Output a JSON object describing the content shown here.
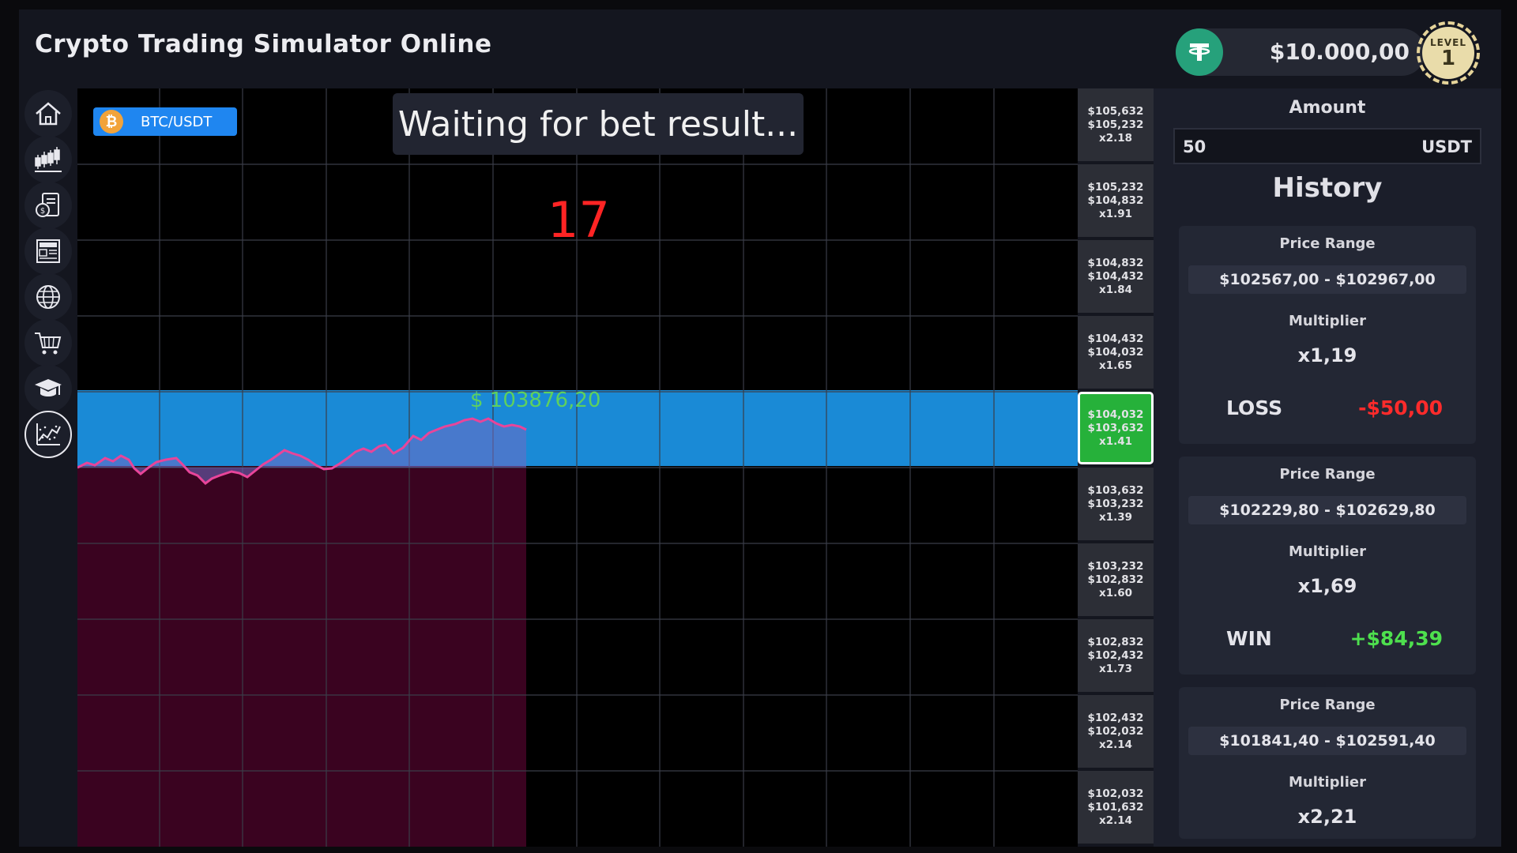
{
  "header": {
    "title": "Crypto Trading Simulator Online",
    "balance": "$10.000,00",
    "level_label": "LEVEL",
    "level_value": "1"
  },
  "sidebar": {
    "items": [
      {
        "name": "home",
        "icon": "home-icon"
      },
      {
        "name": "chart",
        "icon": "candlestick-chart-icon"
      },
      {
        "name": "coins",
        "icon": "coins-document-icon"
      },
      {
        "name": "news",
        "icon": "news-icon"
      },
      {
        "name": "globe",
        "icon": "globe-icon"
      },
      {
        "name": "shop",
        "icon": "shopping-cart-icon"
      },
      {
        "name": "learn",
        "icon": "graduation-cap-icon"
      },
      {
        "name": "stats",
        "icon": "statistics-chart-icon"
      }
    ]
  },
  "chart": {
    "pair": "BTC/USDT",
    "pair_icon": "bitcoin-icon",
    "status": "Waiting for bet result...",
    "countdown": "17",
    "current_price": "$ 103876,20",
    "colors": {
      "band": "#1a8ad6",
      "fill": "#3a0320",
      "line": "#e8459a",
      "price": "#5ed05e"
    }
  },
  "multipliers": [
    {
      "high": "$105,632",
      "low": "$105,232",
      "mult": "x2.18"
    },
    {
      "high": "$105,232",
      "low": "$104,832",
      "mult": "x1.91"
    },
    {
      "high": "$104,832",
      "low": "$104,432",
      "mult": "x1.84"
    },
    {
      "high": "$104,432",
      "low": "$104,032",
      "mult": "x1.65"
    },
    {
      "high": "$104,032",
      "low": "$103,632",
      "mult": "x1.41",
      "active": true
    },
    {
      "high": "$103,632",
      "low": "$103,232",
      "mult": "x1.39"
    },
    {
      "high": "$103,232",
      "low": "$102,832",
      "mult": "x1.60"
    },
    {
      "high": "$102,832",
      "low": "$102,432",
      "mult": "x1.73"
    },
    {
      "high": "$102,432",
      "low": "$102,032",
      "mult": "x2.14"
    },
    {
      "high": "$102,032",
      "low": "$101,632",
      "mult": "x2.14"
    }
  ],
  "amount": {
    "title": "Amount",
    "value": "50",
    "unit": "USDT"
  },
  "history": {
    "title": "History",
    "price_range_label": "Price Range",
    "multiplier_label": "Multiplier",
    "entries": [
      {
        "range": "$102567,00 - $102967,00",
        "multiplier": "x1,19",
        "result": "LOSS",
        "amount": "-$50,00"
      },
      {
        "range": "$102229,80 - $102629,80",
        "multiplier": "x1,69",
        "result": "WIN",
        "amount": "+$84,39"
      },
      {
        "range": "$101841,40 - $102591,40",
        "multiplier": "x2,21"
      }
    ]
  }
}
